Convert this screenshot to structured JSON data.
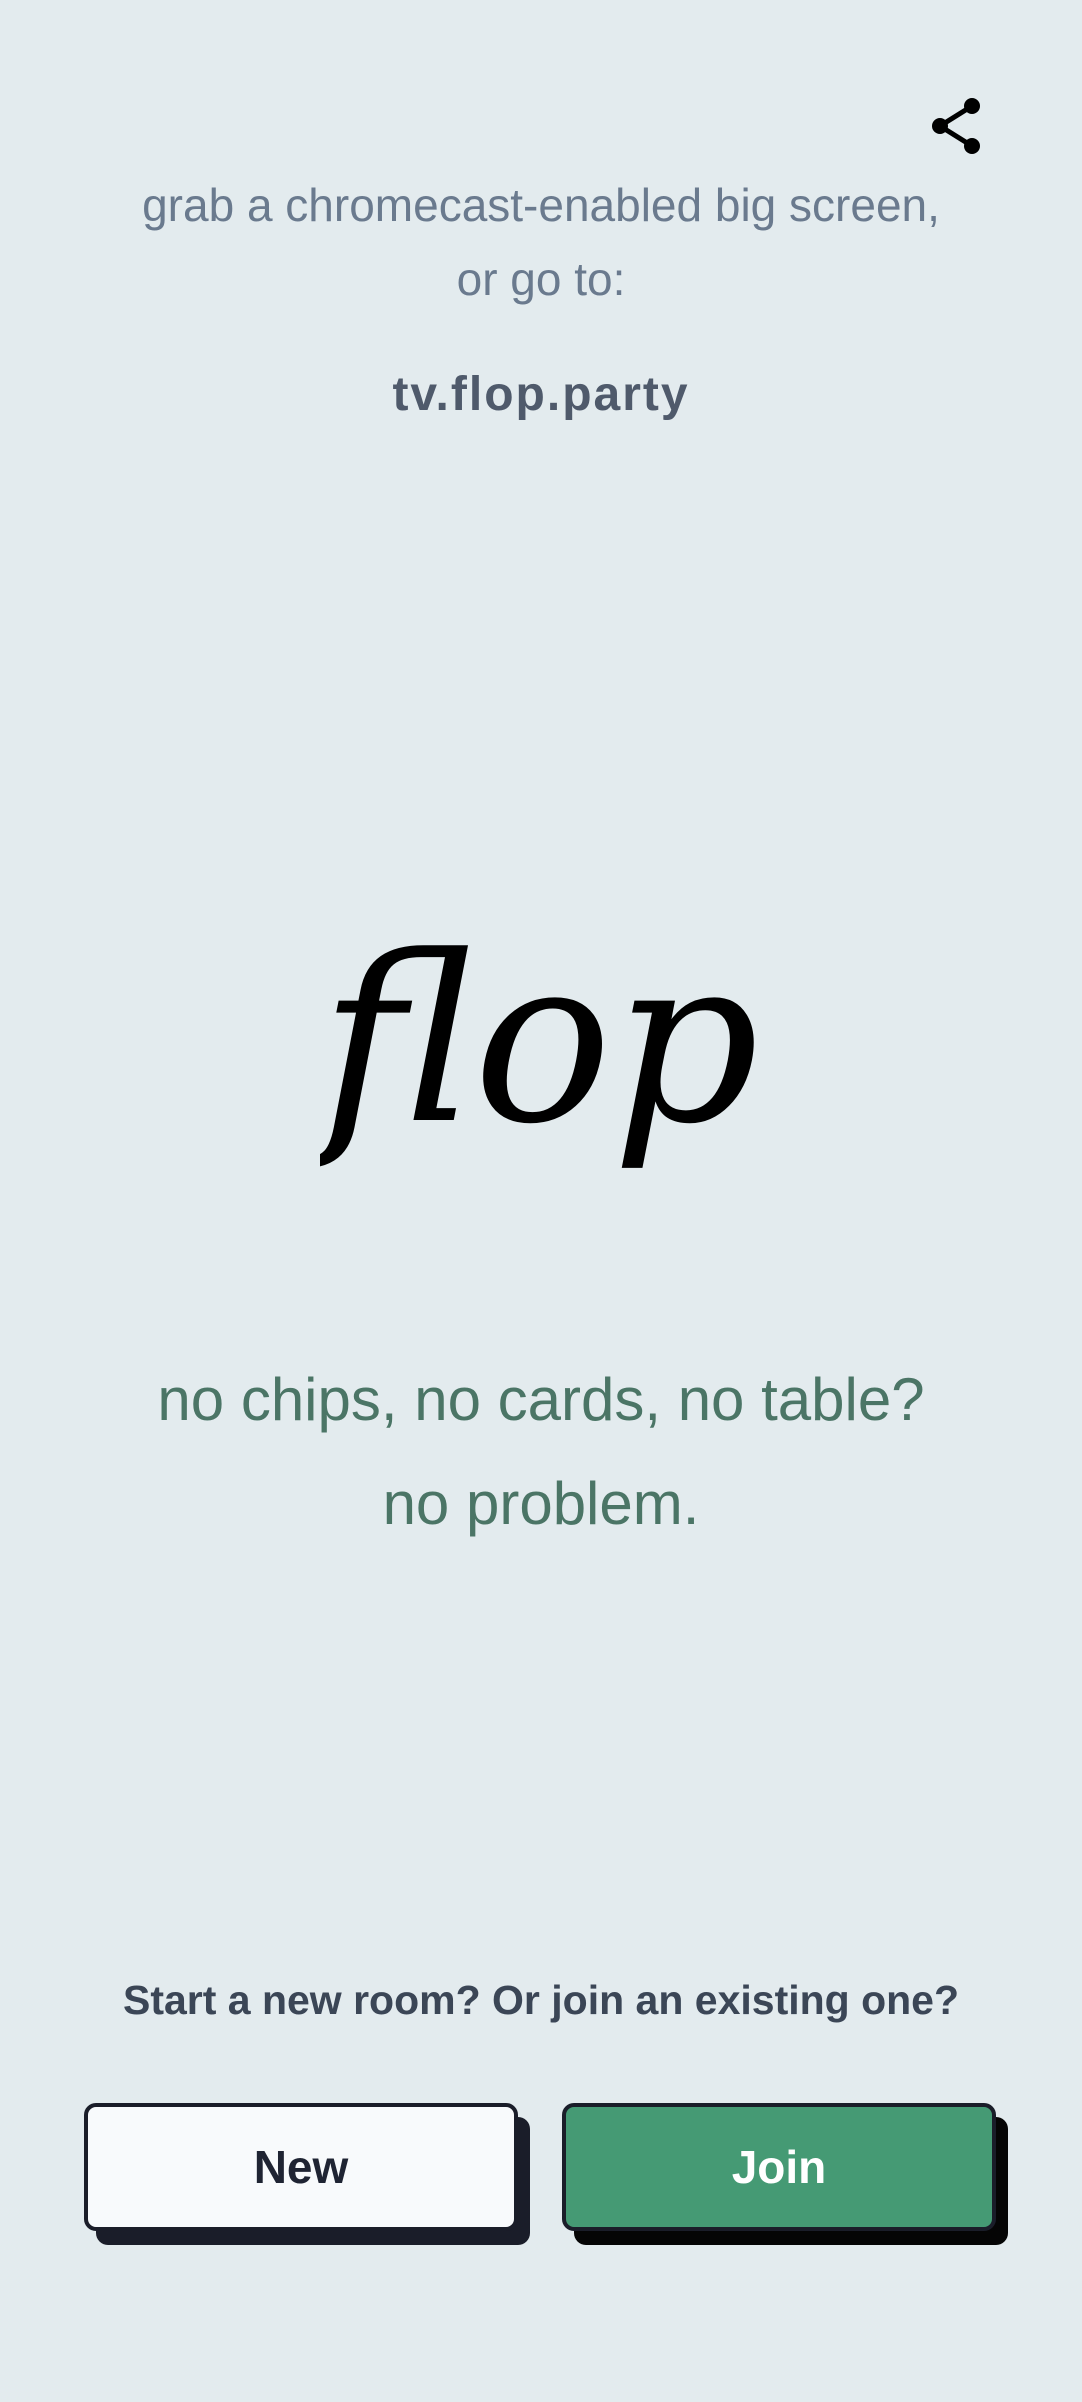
{
  "header": {
    "share_icon": "share-icon",
    "cast_hint": "grab a chromecast-enabled big screen, or go to:",
    "tv_url": "tv.flop.party"
  },
  "hero": {
    "logo_text": "flop.",
    "tagline_line1": "no chips, no cards, no table?",
    "tagline_line2": "no problem."
  },
  "actions": {
    "prompt": "Start a new room? Or join an existing one?",
    "new_label": "New",
    "join_label": "Join"
  },
  "colors": {
    "background": "#e3ebee",
    "join_button": "#459a74",
    "new_button": "#f8fafc",
    "tagline": "#4b7566",
    "hint_text": "#6a7a8e"
  }
}
